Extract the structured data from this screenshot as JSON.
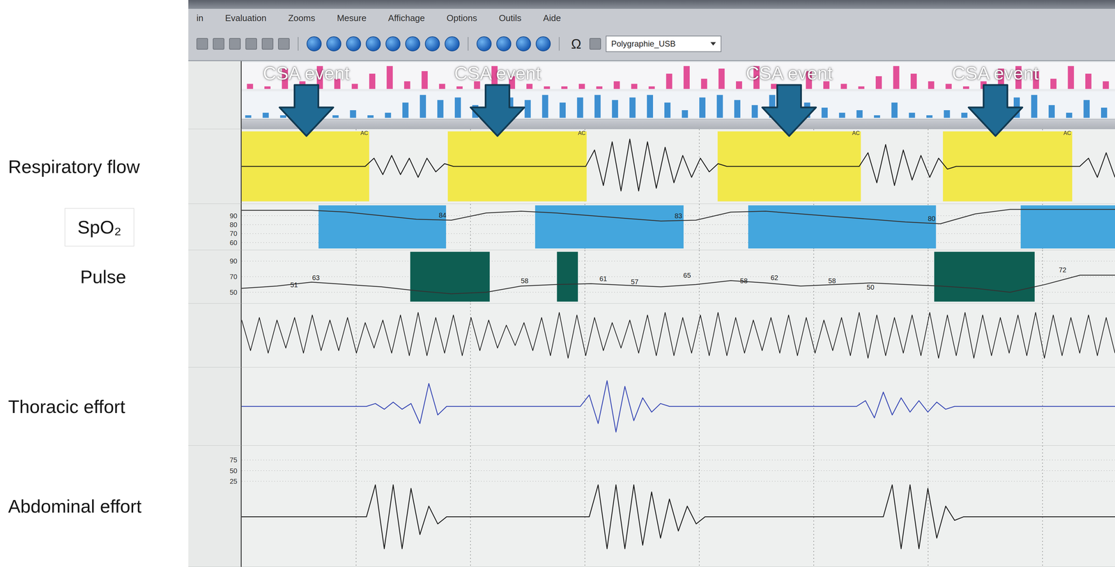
{
  "toolbar": {
    "menu": [
      "in",
      "Evaluation",
      "Zooms",
      "Mesure",
      "Affichage",
      "Options",
      "Outils",
      "Aide"
    ],
    "glyph": "Ω",
    "dropdown": "Polygraphie_USB"
  },
  "time_axis": {
    "start": 0,
    "end": 100
  },
  "annotations": [
    {
      "label": "CSA event",
      "time": 7.4
    },
    {
      "label": "CSA event",
      "time": 29.3
    },
    {
      "label": "CSA event",
      "time": 62.7
    },
    {
      "label": "CSA event",
      "time": 86.3
    }
  ],
  "overview": {
    "pink": [
      0.2,
      0.1,
      0.8,
      0.3,
      0.9,
      0.4,
      0.2,
      0.6,
      0.9,
      0.3,
      0.7,
      0.2,
      0.1,
      0.3,
      0.9,
      0.5,
      0.2,
      0.1,
      0.1,
      0.2,
      0.1,
      0.3,
      0.2,
      0.1,
      0.6,
      0.9,
      0.4,
      0.8,
      0.3,
      0.9,
      0.2,
      0.1,
      0.7,
      0.3,
      0.2,
      0.1,
      0.5,
      0.9,
      0.6,
      0.3,
      0.2,
      0.1,
      0.3,
      0.8,
      0.9,
      0.7,
      0.4,
      0.9,
      0.6,
      0.3
    ],
    "blue": [
      0.1,
      0.2,
      0.1,
      0.4,
      0.2,
      0.1,
      0.3,
      0.1,
      0.2,
      0.6,
      0.9,
      0.7,
      0.8,
      0.5,
      0.9,
      0.8,
      0.7,
      0.9,
      0.6,
      0.8,
      0.9,
      0.7,
      0.8,
      0.9,
      0.6,
      0.3,
      0.8,
      0.9,
      0.7,
      0.5,
      0.9,
      0.8,
      0.6,
      0.4,
      0.2,
      0.3,
      0.1,
      0.6,
      0.2,
      0.1,
      0.3,
      0.2,
      0.4,
      0.1,
      0.8,
      0.9,
      0.5,
      0.2,
      0.7,
      0.4
    ]
  },
  "channels": [
    {
      "label": "Respiratory flow",
      "kind": "flow",
      "min": -1.2,
      "max": 1.2,
      "scale": [],
      "values": [
        0,
        0,
        0,
        0,
        0,
        0,
        0,
        0,
        0,
        0,
        0,
        0,
        0,
        0,
        0,
        0.3,
        -0.3,
        0.4,
        -0.3,
        0.3,
        -0.4,
        0.3,
        -0.2,
        0.1,
        0,
        0,
        0,
        0,
        0,
        0,
        0,
        0,
        0,
        0,
        0,
        0,
        0,
        0,
        0,
        0,
        0.6,
        -0.7,
        0.9,
        -0.9,
        1,
        -0.9,
        0.9,
        -0.8,
        0.7,
        -0.6,
        0.4,
        -0.4,
        0.3,
        -0.2,
        0.1,
        0,
        0,
        0,
        0,
        0,
        0,
        0,
        0,
        0,
        0,
        0,
        0,
        0,
        0,
        0,
        0,
        0.5,
        -0.6,
        0.8,
        -0.7,
        0.6,
        -0.5,
        0.4,
        -0.4,
        0.3,
        -0.1,
        0,
        0,
        0,
        0,
        0,
        0,
        0,
        0,
        0,
        0,
        0,
        0,
        0,
        0,
        0,
        0.3,
        -0.4,
        0.5,
        -0.4
      ],
      "events": [
        {
          "start": 0,
          "end": 14.6,
          "tag": "AC",
          "color": "#f2e84b"
        },
        {
          "start": 23.6,
          "end": 39.5,
          "tag": "AC",
          "color": "#f2e84b"
        },
        {
          "start": 54.5,
          "end": 70.9,
          "tag": "AC",
          "color": "#f2e84b"
        },
        {
          "start": 80.3,
          "end": 95.1,
          "tag": "AC",
          "color": "#f2e84b"
        }
      ],
      "marks": []
    },
    {
      "label": "SpO₂",
      "kind": "spo2",
      "min": 55,
      "max": 100,
      "scale": [
        {
          "label": "90",
          "value": 90
        },
        {
          "label": "80",
          "value": 80
        },
        {
          "label": "70",
          "value": 70
        },
        {
          "label": "60",
          "value": 60
        }
      ],
      "values": [
        96,
        96,
        96,
        94,
        90,
        86,
        85,
        93,
        95,
        93,
        90,
        87,
        84,
        85,
        94,
        95,
        92,
        89,
        86,
        83,
        81,
        92,
        97,
        97,
        97,
        97
      ],
      "events": [
        {
          "start": 8.8,
          "end": 23.4,
          "color": "#44a6dd"
        },
        {
          "start": 33.6,
          "end": 50.6,
          "color": "#44a6dd"
        },
        {
          "start": 58,
          "end": 79.5,
          "color": "#44a6dd"
        },
        {
          "start": 89.2,
          "end": 100,
          "color": "#44a6dd"
        }
      ],
      "marks": [
        {
          "time": 23,
          "y": 85,
          "value": "84"
        },
        {
          "time": 50,
          "y": 84,
          "value": "83"
        },
        {
          "time": 79,
          "y": 81,
          "value": "80"
        }
      ]
    },
    {
      "label": "Pulse",
      "kind": "pulse",
      "min": 40,
      "max": 100,
      "scale": [
        {
          "label": "90",
          "value": 90
        },
        {
          "label": "70",
          "value": 70
        },
        {
          "label": "50",
          "value": 50
        }
      ],
      "values": [
        55,
        58,
        63,
        60,
        57,
        52,
        48,
        50,
        58,
        60,
        61,
        59,
        57,
        60,
        65,
        62,
        58,
        60,
        62,
        60,
        58,
        55,
        50,
        60,
        72,
        72
      ],
      "events": [
        {
          "start": 19.3,
          "end": 28.4,
          "color": "#0e5e52"
        },
        {
          "start": 36.1,
          "end": 38.5,
          "color": "#0e5e52"
        },
        {
          "start": 79.3,
          "end": 90.8,
          "color": "#0e5e52"
        }
      ],
      "marks": [
        {
          "time": 6,
          "y": 53,
          "value": "51"
        },
        {
          "time": 8.5,
          "y": 62,
          "value": "63"
        },
        {
          "time": 32.4,
          "y": 58,
          "value": "58"
        },
        {
          "time": 41.4,
          "y": 61,
          "value": "61"
        },
        {
          "time": 45,
          "y": 57,
          "value": "57"
        },
        {
          "time": 51,
          "y": 65,
          "value": "65"
        },
        {
          "time": 57.5,
          "y": 58,
          "value": "58"
        },
        {
          "time": 61,
          "y": 62,
          "value": "62"
        },
        {
          "time": 67.6,
          "y": 58,
          "value": "58"
        },
        {
          "time": 72,
          "y": 50,
          "value": "50"
        },
        {
          "time": 94,
          "y": 72,
          "value": "72"
        }
      ]
    },
    {
      "kind": "signal",
      "min": -1.1,
      "max": 1.1,
      "scale": [],
      "values": [
        0.6,
        -0.6,
        0.7,
        -0.7,
        0.6,
        -0.5,
        0.7,
        -0.7,
        0.8,
        -0.6,
        0.6,
        -0.6,
        0.7,
        -0.7,
        0.5,
        -0.5,
        0.6,
        -0.7,
        0.8,
        -0.8,
        0.9,
        -0.8,
        0.7,
        -0.7,
        0.8,
        -0.8,
        0.7,
        -0.6,
        0.6,
        -0.5,
        0.4,
        -0.4,
        0.5,
        -0.6,
        0.7,
        -0.8,
        0.9,
        -0.9,
        0.8,
        -0.8,
        0.7,
        -0.6,
        0.5,
        -0.5,
        0.6,
        -0.7,
        0.8,
        -0.8,
        0.9,
        -0.8,
        0.7,
        -0.7,
        0.8,
        -0.8,
        0.9,
        -0.8,
        0.7,
        -0.7,
        0.6,
        -0.6,
        0.7,
        -0.7,
        0.8,
        -0.8,
        0.7,
        -0.7,
        0.6,
        -0.6,
        0.7,
        -0.8,
        0.9,
        -0.9,
        0.8,
        -0.8,
        0.7,
        -0.7,
        0.8,
        -0.8,
        0.9,
        -0.9,
        0.8,
        -0.8,
        0.9,
        -0.9,
        0.8,
        -0.8,
        0.7,
        -0.7,
        0.8,
        -0.8,
        0.9,
        -0.9,
        0.8,
        -0.8,
        0.7,
        -0.7,
        0.8,
        -0.8,
        0.7,
        -0.7
      ],
      "events": [],
      "marks": []
    },
    {
      "label": "Thoracic effort",
      "kind": "thoracic",
      "min": -1.2,
      "max": 1.2,
      "scale": [],
      "values": [
        0,
        0,
        0,
        0,
        0,
        0,
        0,
        0,
        0,
        0,
        0,
        0,
        0,
        0,
        0,
        0.1,
        -0.1,
        0.15,
        -0.1,
        0.1,
        -0.6,
        0.8,
        -0.3,
        0,
        0,
        0,
        0,
        0,
        0,
        0,
        0,
        0,
        0,
        0,
        0,
        0,
        0,
        0,
        0,
        0.4,
        -0.6,
        0.9,
        -0.9,
        0.7,
        -0.5,
        0.3,
        -0.2,
        0.1,
        0,
        0,
        0,
        0,
        0,
        0,
        0,
        0,
        0,
        0,
        0,
        0,
        0,
        0,
        0,
        0,
        0,
        0,
        0,
        0,
        0,
        0,
        0.2,
        -0.4,
        0.5,
        -0.3,
        0.3,
        -0.2,
        0.2,
        -0.2,
        0.15,
        -0.1,
        0,
        0,
        0,
        0,
        0,
        0,
        0,
        0,
        0,
        0,
        0,
        0,
        0,
        0,
        0,
        0,
        0,
        0,
        0
      ],
      "events": [],
      "marks": []
    },
    {
      "label": "Abdominal effort",
      "kind": "abdominal",
      "min": -1.2,
      "max": 1.8,
      "scale": [
        {
          "label": "75",
          "value": 1.6
        },
        {
          "label": "50",
          "value": 1.3
        },
        {
          "label": "25",
          "value": 1.0
        }
      ],
      "values": [
        0,
        0,
        0,
        0,
        0,
        0,
        0,
        0,
        0,
        0,
        0,
        0,
        0,
        0,
        0,
        0.9,
        -0.9,
        0.9,
        -0.9,
        0.8,
        -0.5,
        0.3,
        -0.2,
        0,
        0,
        0,
        0,
        0,
        0,
        0,
        0,
        0,
        0,
        0,
        0,
        0,
        0,
        0,
        0,
        0,
        0.9,
        -0.9,
        0.9,
        -0.9,
        0.9,
        -0.8,
        0.7,
        -0.6,
        0.5,
        -0.4,
        0.3,
        -0.2,
        0,
        0,
        0,
        0,
        0,
        0,
        0,
        0,
        0,
        0,
        0,
        0,
        0,
        0,
        0,
        0,
        0,
        0,
        0,
        0,
        0,
        0.9,
        -0.9,
        0.9,
        -0.9,
        0.8,
        -0.6,
        0.3,
        -0.1,
        0,
        0,
        0,
        0,
        0,
        0,
        0,
        0,
        0,
        0,
        0,
        0,
        0,
        0,
        0,
        0,
        0,
        0
      ],
      "events": [],
      "marks": []
    }
  ]
}
